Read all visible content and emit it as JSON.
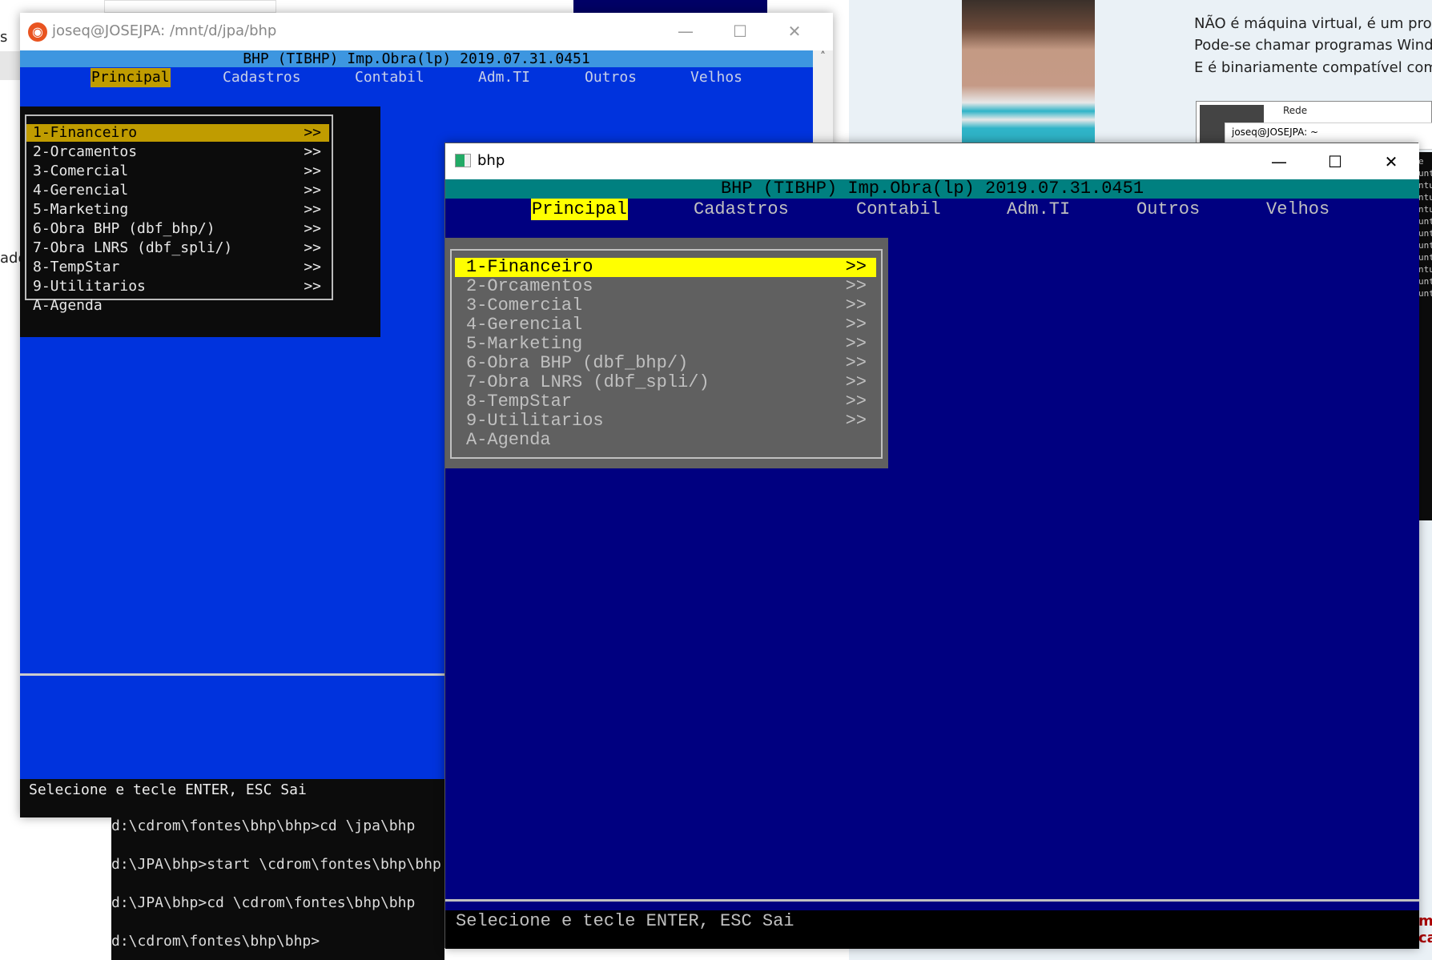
{
  "background": {
    "web_text": [
      "NÃO é máquina virtual, é um prom",
      "Pode-se chamar programas Windov",
      "E é binariamente compatível com"
    ],
    "thumb_label": "Rede",
    "thumb_window_title": "joseq@JOSEJPA: ~",
    "edge_left_1": "s",
    "edge_left_2": "ado",
    "strip_lines": [
      "e",
      "unt",
      "ntu",
      "ntu",
      "ntu",
      "unt",
      "unt",
      "unt",
      "unt",
      "ntu",
      "unt",
      "unt"
    ],
    "strip_bottom": [
      "m",
      "ca"
    ]
  },
  "window1": {
    "title": "joseq@JOSEJPA: /mnt/d/jpa/bhp",
    "header": "BHP (TIBHP) Imp.Obra(lp) 2019.07.31.0451",
    "menu": [
      "Principal",
      "Cadastros",
      "Contabil",
      "Adm.TI",
      "Outros",
      "Velhos"
    ],
    "items": [
      {
        "label": "1-Financeiro",
        "arrow": ">>"
      },
      {
        "label": "2-Orcamentos",
        "arrow": ">>"
      },
      {
        "label": "3-Comercial",
        "arrow": ">>"
      },
      {
        "label": "4-Gerencial",
        "arrow": ">>"
      },
      {
        "label": "5-Marketing",
        "arrow": ">>"
      },
      {
        "label": "6-Obra BHP (dbf_bhp/)",
        "arrow": ">>"
      },
      {
        "label": "7-Obra LNRS (dbf_spli/)",
        "arrow": ">>"
      },
      {
        "label": "8-TempStar",
        "arrow": ">>"
      },
      {
        "label": "9-Utilitarios",
        "arrow": ">>"
      },
      {
        "label": "A-Agenda",
        "arrow": ""
      }
    ],
    "status": "Selecione e tecle ENTER, ESC Sai",
    "colors": {
      "background": "#0033dd",
      "header": "#3d96e0",
      "selected": "#c09c00"
    }
  },
  "cmd_terminal": {
    "lines": [
      "d:\\cdrom\\fontes\\bhp\\bhp>cd \\jpa\\bhp",
      "d:\\JPA\\bhp>start \\cdrom\\fontes\\bhp\\bhp",
      "d:\\JPA\\bhp>cd \\cdrom\\fontes\\bhp\\bhp",
      "d:\\cdrom\\fontes\\bhp\\bhp>"
    ]
  },
  "window2": {
    "title": "bhp",
    "header": "BHP (TIBHP) Imp.Obra(lp) 2019.07.31.0451",
    "menu": [
      "Principal",
      "Cadastros",
      "Contabil",
      "Adm.TI",
      "Outros",
      "Velhos"
    ],
    "items": [
      {
        "label": "1-Financeiro",
        "arrow": ">>"
      },
      {
        "label": "2-Orcamentos",
        "arrow": ">>"
      },
      {
        "label": "3-Comercial",
        "arrow": ">>"
      },
      {
        "label": "4-Gerencial",
        "arrow": ">>"
      },
      {
        "label": "5-Marketing",
        "arrow": ">>"
      },
      {
        "label": "6-Obra BHP (dbf_bhp/)",
        "arrow": ">>"
      },
      {
        "label": "7-Obra LNRS (dbf_spli/)",
        "arrow": ">>"
      },
      {
        "label": "8-TempStar",
        "arrow": ">>"
      },
      {
        "label": "9-Utilitarios",
        "arrow": ">>"
      },
      {
        "label": "A-Agenda",
        "arrow": ""
      }
    ],
    "status": "Selecione e tecle ENTER, ESC Sai",
    "colors": {
      "background": "#000080",
      "header": "#008080",
      "selected": "#ffff00",
      "menu_box": "#606060"
    }
  },
  "window_controls": {
    "minimize": "—",
    "maximize": "☐",
    "close": "✕"
  }
}
